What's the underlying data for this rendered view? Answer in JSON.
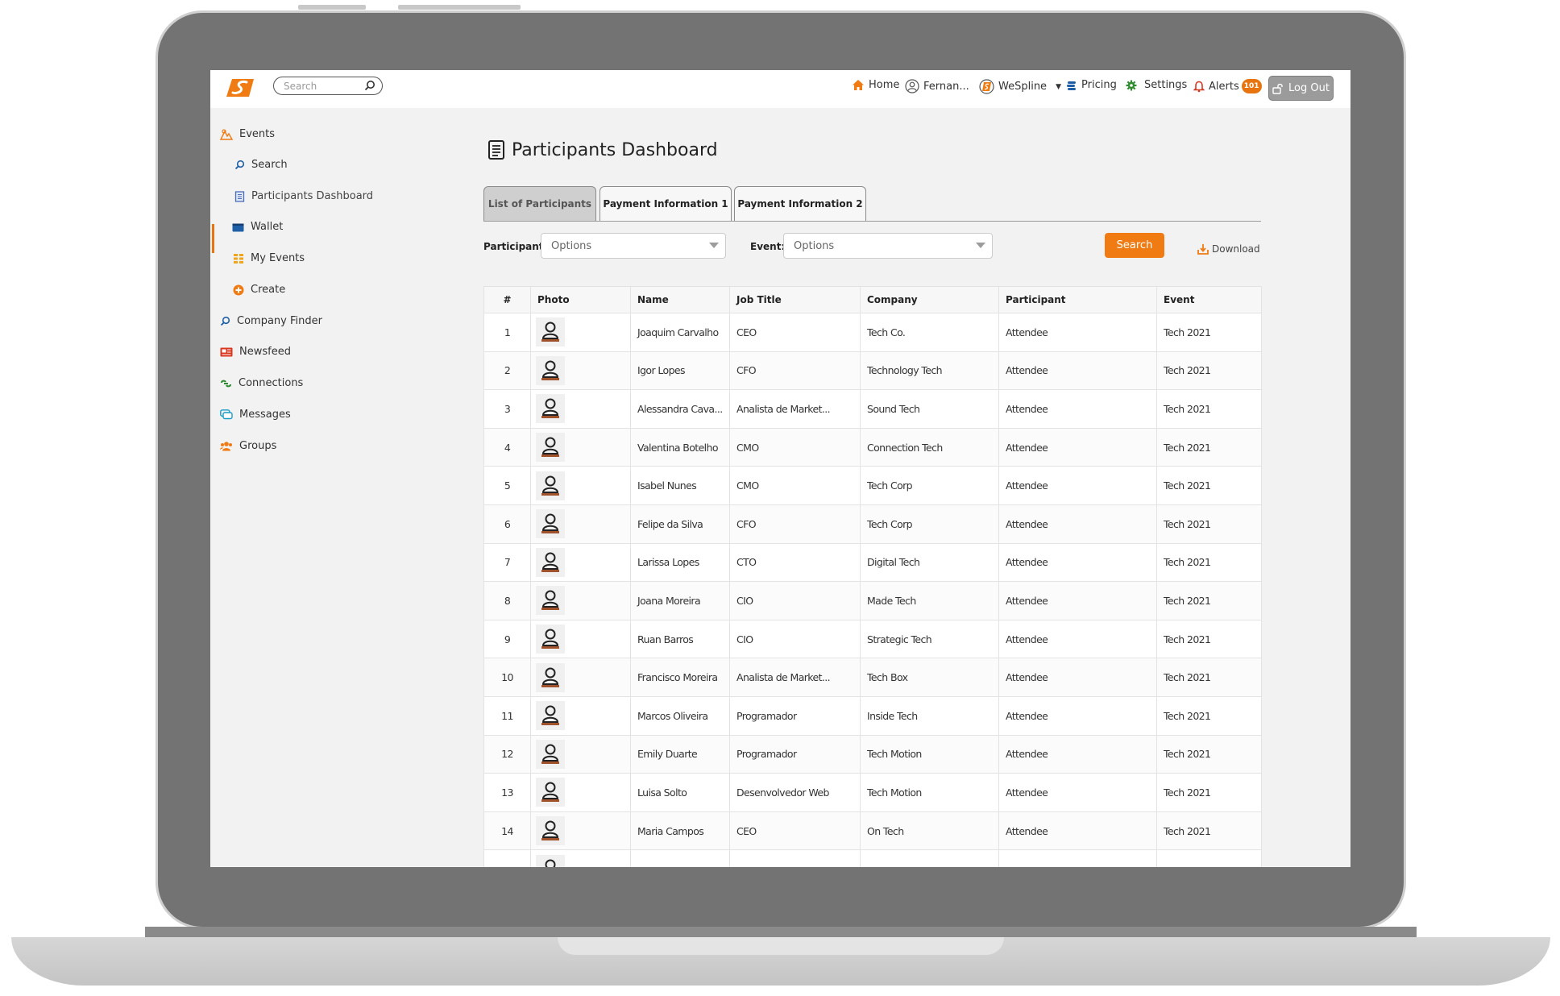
{
  "app": {
    "search_placeholder": "Search"
  },
  "nav": {
    "home": "Home",
    "user": "Fernan...",
    "brand": "WeSpline",
    "pricing": "Pricing",
    "settings": "Settings",
    "alerts": "Alerts",
    "alerts_count": "101",
    "logout": "Log Out"
  },
  "sidebar": {
    "items": [
      {
        "label": "Events",
        "icon": "events-icon"
      },
      {
        "label": "Search",
        "icon": "search-icon"
      },
      {
        "label": "Participants Dashboard",
        "icon": "document-icon"
      },
      {
        "label": "Wallet",
        "icon": "wallet-icon"
      },
      {
        "label": "My Events",
        "icon": "my-events-icon"
      },
      {
        "label": "Create",
        "icon": "plus-circle-icon"
      },
      {
        "label": "Company Finder",
        "icon": "search-icon"
      },
      {
        "label": "Newsfeed",
        "icon": "newsfeed-icon"
      },
      {
        "label": "Connections",
        "icon": "connections-icon"
      },
      {
        "label": "Messages",
        "icon": "messages-icon"
      },
      {
        "label": "Groups",
        "icon": "groups-icon"
      }
    ]
  },
  "main": {
    "title": "Participants Dashboard",
    "tabs": [
      "List of Participants",
      "Payment Information 1",
      "Payment Information 2"
    ],
    "filters": {
      "participant_label": "Participant:",
      "participant_value": "Options",
      "event_label": "Event:",
      "event_value": "Options",
      "search_button": "Search",
      "download": "Download"
    },
    "table": {
      "columns": [
        "#",
        "Photo",
        "Name",
        "Job Title",
        "Company",
        "Participant",
        "Event"
      ],
      "rows": [
        [
          "1",
          "Joaquim Carvalho",
          "CEO",
          "Tech Co.",
          "Attendee",
          "Tech 2021"
        ],
        [
          "2",
          "Igor Lopes",
          "CFO",
          "Technology Tech",
          "Attendee",
          "Tech 2021"
        ],
        [
          "3",
          "Alessandra Cava...",
          "Analista de Market...",
          "Sound Tech",
          "Attendee",
          "Tech 2021"
        ],
        [
          "4",
          "Valentina Botelho",
          "CMO",
          "Connection Tech",
          "Attendee",
          "Tech 2021"
        ],
        [
          "5",
          "Isabel Nunes",
          "CMO",
          "Tech Corp",
          "Attendee",
          "Tech 2021"
        ],
        [
          "6",
          "Felipe da Silva",
          "CFO",
          "Tech Corp",
          "Attendee",
          "Tech 2021"
        ],
        [
          "7",
          "Larissa Lopes",
          "CTO",
          "Digital Tech",
          "Attendee",
          "Tech 2021"
        ],
        [
          "8",
          "Joana Moreira",
          "CIO",
          "Made Tech",
          "Attendee",
          "Tech 2021"
        ],
        [
          "9",
          "Ruan Barros",
          "CIO",
          "Strategic Tech",
          "Attendee",
          "Tech 2021"
        ],
        [
          "10",
          "Francisco Moreira",
          "Analista de Market...",
          "Tech Box",
          "Attendee",
          "Tech 2021"
        ],
        [
          "11",
          "Marcos Oliveira",
          "Programador",
          "Inside Tech",
          "Attendee",
          "Tech 2021"
        ],
        [
          "12",
          "Emily Duarte",
          "Programador",
          "Tech Motion",
          "Attendee",
          "Tech 2021"
        ],
        [
          "13",
          "Luisa Solto",
          "Desenvolvedor Web",
          "Tech Motion",
          "Attendee",
          "Tech 2021"
        ],
        [
          "14",
          "Maria Campos",
          "CEO",
          "On Tech",
          "Attendee",
          "Tech 2021"
        ],
        [
          "",
          "",
          "",
          "",
          "",
          ""
        ]
      ]
    }
  },
  "colors": {
    "accent": "#f07b12",
    "frame": "#737373",
    "screen_bg": "#f2f2f2"
  }
}
